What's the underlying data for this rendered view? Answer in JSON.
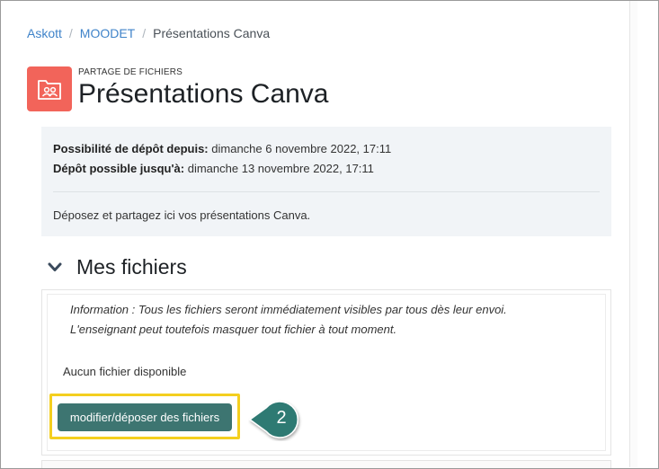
{
  "breadcrumb": {
    "items": [
      "Askott",
      "MOODET"
    ],
    "current": "Présentations Canva",
    "separator": "/"
  },
  "activity": {
    "type_label": "PARTAGE DE FICHIERS",
    "title": "Présentations Canva",
    "icon": "folder-users-icon",
    "icon_color": "#f2645a"
  },
  "dates": {
    "open_label": "Possibilité de dépôt depuis:",
    "open_value": "dimanche 6 novembre 2022, 17:11",
    "close_label": "Dépôt possible jusqu'à:",
    "close_value": "dimanche 13 novembre 2022, 17:11",
    "description": "Déposez et partagez ici vos présentations Canva."
  },
  "section": {
    "title": "Mes fichiers",
    "notice_line1": "Information : Tous les fichiers seront immédiatement visibles par tous dès leur envoi.",
    "notice_line2": "L'enseignant peut toutefois masquer tout fichier à tout moment.",
    "empty_text": "Aucun fichier disponible",
    "button_label": "modifier/déposer des fichiers",
    "button_color": "#3d7571"
  },
  "annotation": {
    "number": "2",
    "highlight_color": "#f4cf1f",
    "callout_color": "#2e7a73"
  }
}
